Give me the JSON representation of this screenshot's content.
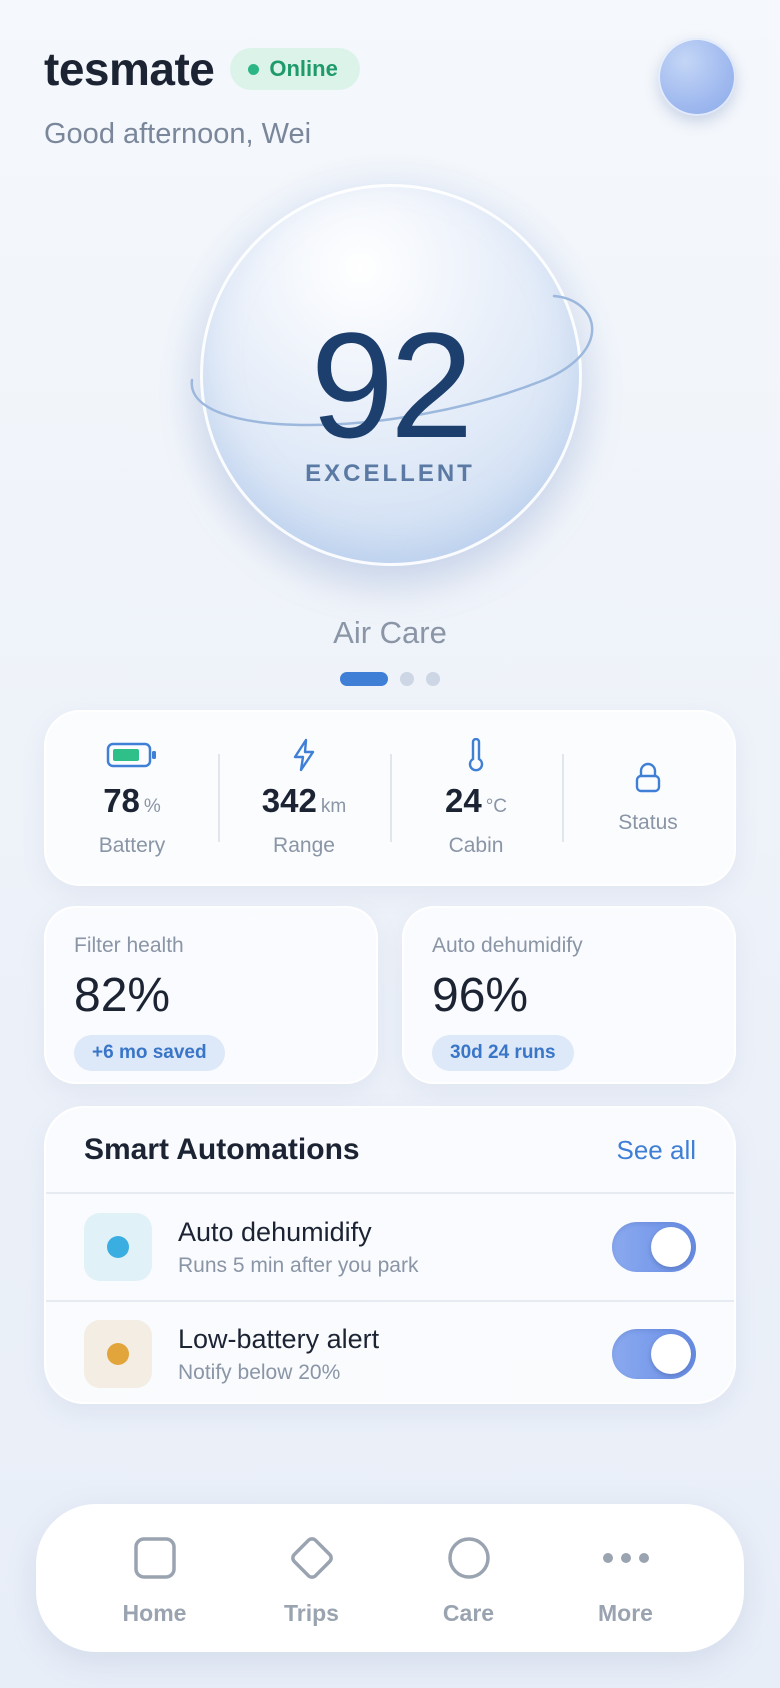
{
  "header": {
    "brand": "tesmate",
    "status": "Online",
    "greeting": "Good afternoon, Wei"
  },
  "score": {
    "value": "92",
    "label": "EXCELLENT",
    "title": "Air Care",
    "pages": 3,
    "active_page": 0
  },
  "stats": [
    {
      "icon": "battery-icon",
      "value": "78",
      "unit": "%",
      "label": "Battery"
    },
    {
      "icon": "lightning-icon",
      "value": "342",
      "unit": "km",
      "label": "Range"
    },
    {
      "icon": "thermometer-icon",
      "value": "24",
      "unit": "°C",
      "label": "Cabin"
    },
    {
      "icon": "lock-icon",
      "label": "Status"
    }
  ],
  "metrics": [
    {
      "title": "Filter health",
      "value": "82%",
      "chip": "+6 mo saved"
    },
    {
      "title": "Auto dehumidify",
      "value": "96%",
      "chip": "30d 24 runs"
    }
  ],
  "automations": {
    "title": "Smart Automations",
    "see_all": "See all",
    "items": [
      {
        "name": "Auto dehumidify",
        "desc": "Runs 5 min after you park",
        "enabled": true,
        "dot_color": "#3aaee0",
        "bg_color": "#e1f1f8"
      },
      {
        "name": "Low-battery alert",
        "desc": "Notify below 20%",
        "enabled": true,
        "dot_color": "#e2a53c",
        "bg_color": "#f3ede3"
      }
    ]
  },
  "nav": [
    {
      "label": "Home",
      "icon": "square-icon"
    },
    {
      "label": "Trips",
      "icon": "diamond-icon"
    },
    {
      "label": "Care",
      "icon": "circle-icon"
    },
    {
      "label": "More",
      "icon": "more-dots-icon"
    }
  ],
  "colors": {
    "accent": "#3f7fd6",
    "online": "#2cb685",
    "score": "#1d3f6e"
  }
}
